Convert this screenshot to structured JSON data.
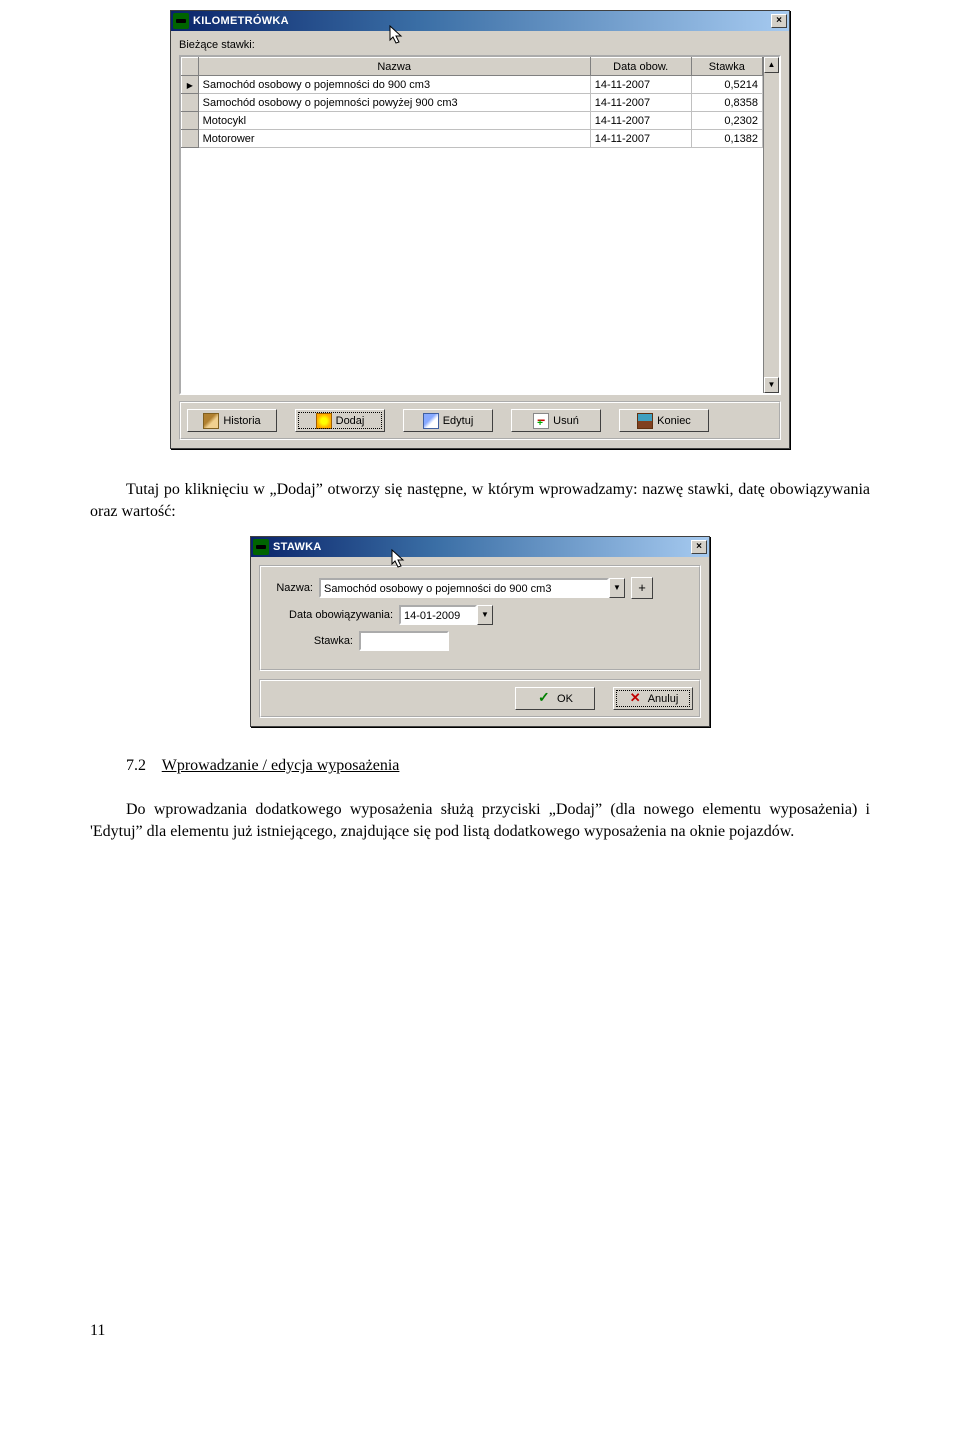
{
  "win1": {
    "title": "KILOMETRÓWKA",
    "list_label": "Bieżące stawki:",
    "columns": {
      "nazwa": "Nazwa",
      "data": "Data obow.",
      "stawka": "Stawka"
    },
    "rows": [
      {
        "nazwa": "Samochód osobowy o pojemności do 900 cm3",
        "data": "14-11-2007",
        "stawka": "0,5214"
      },
      {
        "nazwa": "Samochód osobowy o pojemności powyżej 900 cm3",
        "data": "14-11-2007",
        "stawka": "0,8358"
      },
      {
        "nazwa": "Motocykl",
        "data": "14-11-2007",
        "stawka": "0,2302"
      },
      {
        "nazwa": "Motorower",
        "data": "14-11-2007",
        "stawka": "0,1382"
      }
    ],
    "buttons": {
      "historia": "Historia",
      "dodaj": "Dodaj",
      "edytuj": "Edytuj",
      "usun": "Usuń",
      "koniec": "Koniec"
    },
    "scroll": {
      "up": "▲",
      "down": "▼"
    },
    "close": "×"
  },
  "para1": "Tutaj po kliknięciu w „Dodaj” otworzy się następne,  w którym wprowadzamy: nazwę stawki, datę obowiązywania oraz wartość:",
  "win2": {
    "title": "STAWKA",
    "close": "×",
    "labels": {
      "nazwa": "Nazwa:",
      "data": "Data obowiązywania:",
      "stawka": "Stawka:"
    },
    "values": {
      "nazwa": "Samochód osobowy o pojemności do 900 cm3",
      "data": "14-01-2009",
      "stawka": ""
    },
    "plus": "+",
    "buttons": {
      "ok": "OK",
      "anuluj": "Anuluj"
    },
    "dd": "▼"
  },
  "section": {
    "num": "7.2",
    "title": "Wprowadzanie / edycja wyposażenia"
  },
  "para2": "Do wprowadzania dodatkowego wyposażenia służą przyciski „Dodaj” (dla nowego elementu wyposażenia) i 'Edytuj” dla elementu już istniejącego, znajdujące się pod listą dodatkowego wyposażenia na oknie pojazdów.",
  "pagenum": "11"
}
